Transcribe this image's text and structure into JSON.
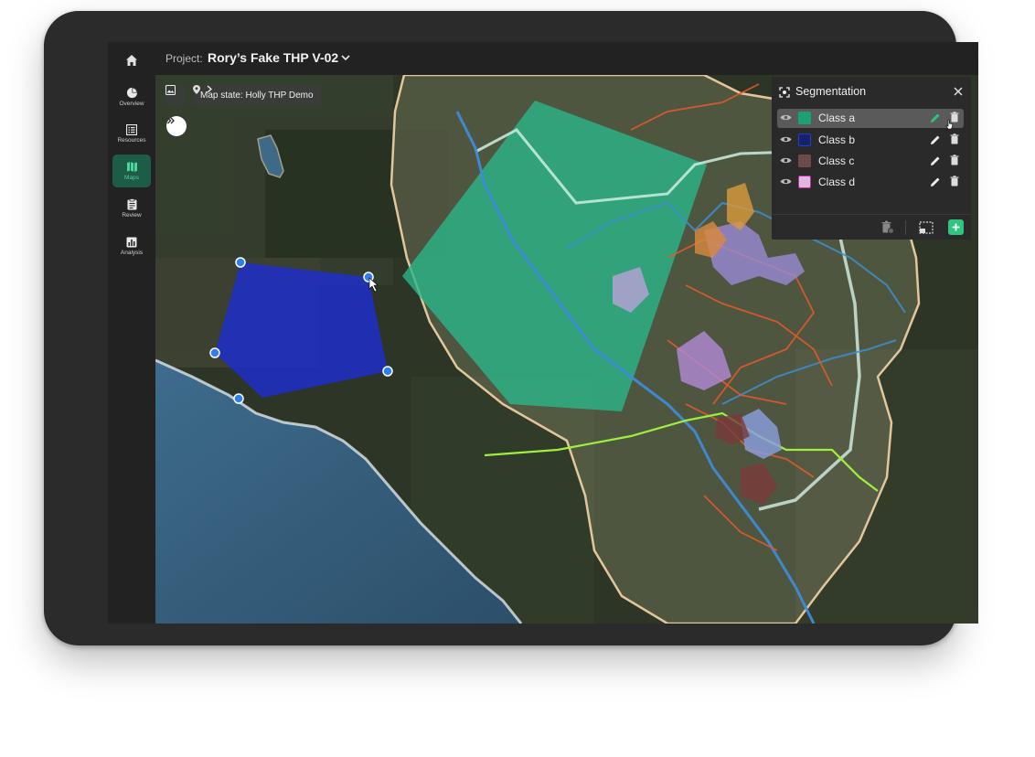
{
  "header": {
    "project_label": "Project:",
    "project_name": "Rory’s Fake THP V-02"
  },
  "sidebar": {
    "items": [
      {
        "label": "Overview",
        "icon": "pie-chart-icon"
      },
      {
        "label": "Resources",
        "icon": "list-icon"
      },
      {
        "label": "Maps",
        "icon": "map-icon",
        "active": true
      },
      {
        "label": "Review",
        "icon": "clipboard-icon"
      },
      {
        "label": "Analysis",
        "icon": "bar-chart-icon"
      }
    ]
  },
  "map": {
    "state_label": "Map state: Holly THP  Demo"
  },
  "segmentation": {
    "title": "Segmentation",
    "classes": [
      {
        "name": "Class a",
        "color": "#1f9e74",
        "selected": true
      },
      {
        "name": "Class b",
        "color": "#1a2aa8"
      },
      {
        "name": "Class c",
        "color": "#6b4a4a"
      },
      {
        "name": "Class d",
        "color": "#e0b8de"
      }
    ]
  },
  "colors": {
    "accent": "#2fc47f",
    "class_a_fill": "#2bb58a",
    "class_b_fill": "#1c2ed0",
    "handle": "#2f7ff0"
  }
}
